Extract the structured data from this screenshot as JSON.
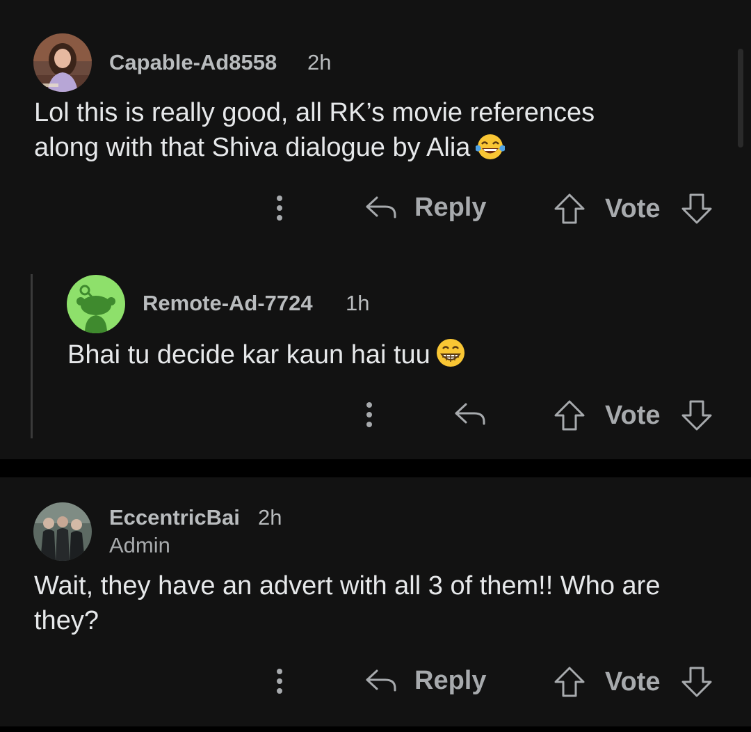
{
  "comments": [
    {
      "username": "Capable-Ad8558",
      "time": "2h",
      "body": "Lol this is really good, all RK’s movie references along with that Shiva dialogue by Alia",
      "emoji": "tears-of-joy-emoji",
      "actions": {
        "reply_label": "Reply",
        "vote_label": "Vote"
      }
    },
    {
      "username": "Remote-Ad-7724",
      "time": "1h",
      "body": "Bhai tu decide kar kaun hai tuu",
      "emoji": "grinning-face-emoji",
      "actions": {
        "vote_label": "Vote"
      }
    },
    {
      "username": "EccentricBai",
      "time": "2h",
      "flair": "Admin",
      "body": "Wait, they have an advert with all 3 of them!! Who are they?",
      "actions": {
        "reply_label": "Reply",
        "vote_label": "Vote"
      }
    }
  ],
  "colors": {
    "background": "#121212",
    "divider": "#000000",
    "text_primary": "#e6e8ea",
    "text_secondary": "#b9bcbe",
    "action": "#a7aaad",
    "snoo_avatar_bg": "#8ee06b"
  }
}
